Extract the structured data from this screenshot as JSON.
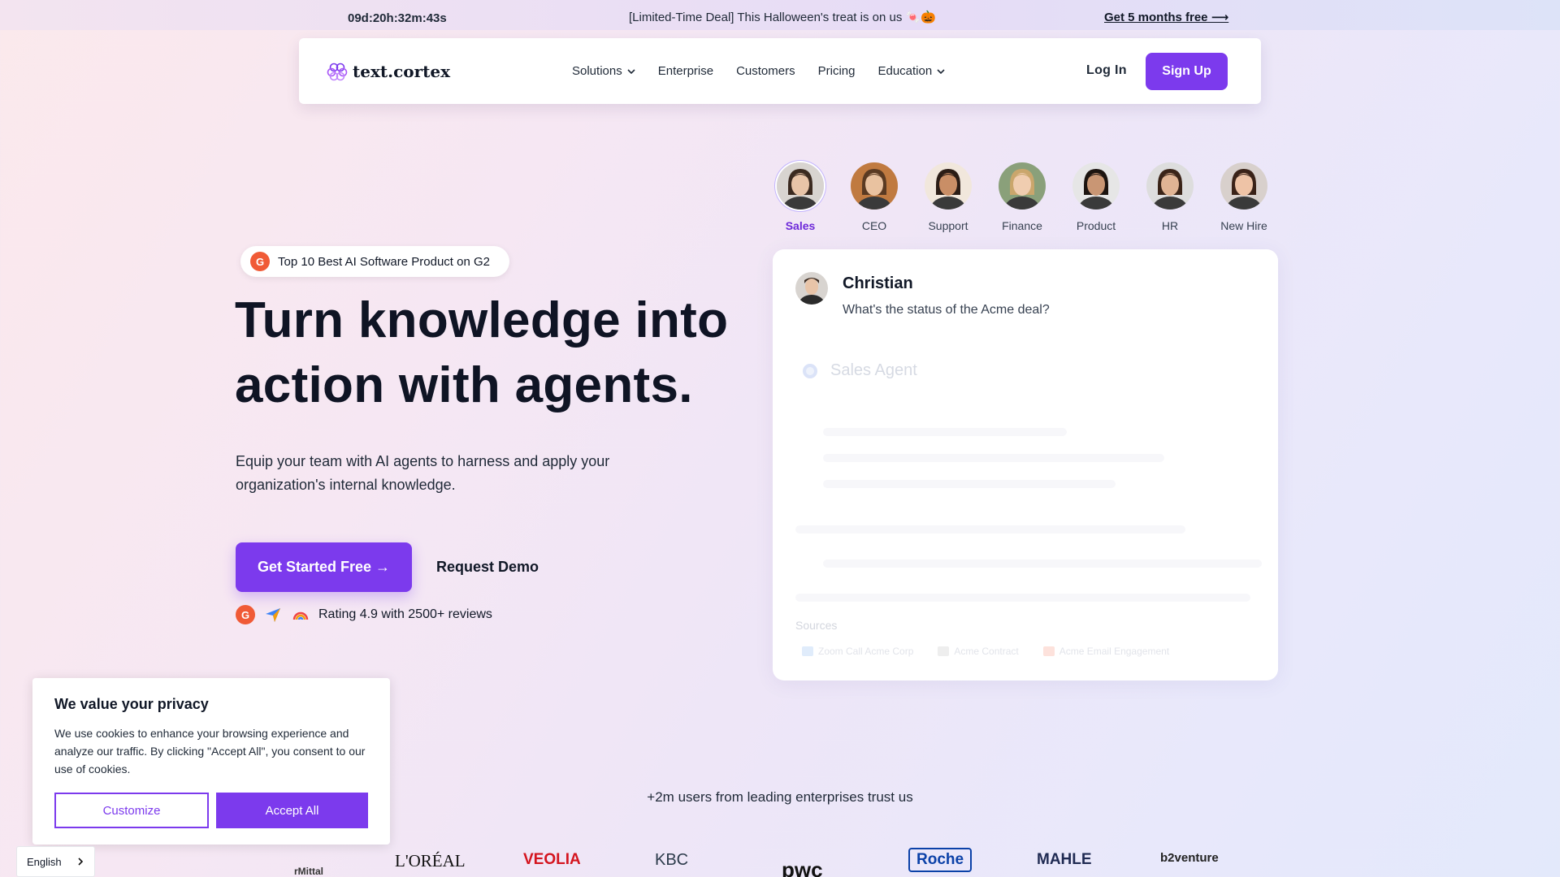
{
  "banner": {
    "countdown": "09d:20h:32m:43s",
    "deal": "[Limited-Time Deal] This Halloween's treat is on us 🍬🎃",
    "cta": "Get 5 months free ⟶"
  },
  "nav": {
    "logo_text": "text.cortex",
    "items": [
      {
        "label": "Solutions",
        "dropdown": true
      },
      {
        "label": "Enterprise",
        "dropdown": false
      },
      {
        "label": "Customers",
        "dropdown": false
      },
      {
        "label": "Pricing",
        "dropdown": false
      },
      {
        "label": "Education",
        "dropdown": true
      }
    ],
    "login": "Log In",
    "signup": "Sign Up"
  },
  "hero": {
    "badge": "Top 10 Best AI Software Product on G2",
    "headline_line1": "Turn knowledge into",
    "headline_line2": "action with agents.",
    "subtext": "Equip your team with AI agents to harness and apply your organization's internal knowledge.",
    "cta": "Get Started Free →",
    "demo": "Request Demo",
    "rating": "Rating 4.9 with 2500+ reviews"
  },
  "roles": [
    {
      "label": "Sales",
      "active": true,
      "skin": "#e8c4a8",
      "hair": "#3b2a20",
      "bg": "#d8d4d0"
    },
    {
      "label": "CEO",
      "active": false,
      "skin": "#e9c2a0",
      "hair": "#5a3a22",
      "bg": "#c07a40"
    },
    {
      "label": "Support",
      "active": false,
      "skin": "#c98e66",
      "hair": "#2b1d16",
      "bg": "#f1e7dc"
    },
    {
      "label": "Finance",
      "active": false,
      "skin": "#f0cdb0",
      "hair": "#caa66c",
      "bg": "#8aa07a"
    },
    {
      "label": "Product",
      "active": false,
      "skin": "#c99674",
      "hair": "#1c1410",
      "bg": "#e6e6e6"
    },
    {
      "label": "HR",
      "active": false,
      "skin": "#e0b494",
      "hair": "#3a2418",
      "bg": "#dddddd"
    },
    {
      "label": "New Hire",
      "active": false,
      "skin": "#eec3a6",
      "hair": "#3a2218",
      "bg": "#d8d0cc"
    }
  ],
  "chat": {
    "user_name": "Christian",
    "message": "What's the status of the Acme deal?",
    "agent_name": "Sales Agent",
    "sources_label": "Sources",
    "sources": [
      "Zoom Call Acme Corp",
      "Acme Contract",
      "Acme Email Engagement"
    ]
  },
  "cookie": {
    "title": "We value your privacy",
    "body": "We use cookies to enhance your browsing experience and analyze our traffic. By clicking \"Accept All\", you consent to our use of cookies.",
    "customize": "Customize",
    "accept": "Accept All"
  },
  "language": "English",
  "trust": {
    "text": "+2m users from leading enterprises trust us",
    "logos": [
      "rMittal",
      "L'ORÉAL",
      "VEOLIA",
      "KBC",
      "pwc",
      "Roche",
      "MAHLE",
      "b2venture"
    ]
  },
  "colors": {
    "accent": "#7c3aed",
    "g2": "#f05a36"
  }
}
